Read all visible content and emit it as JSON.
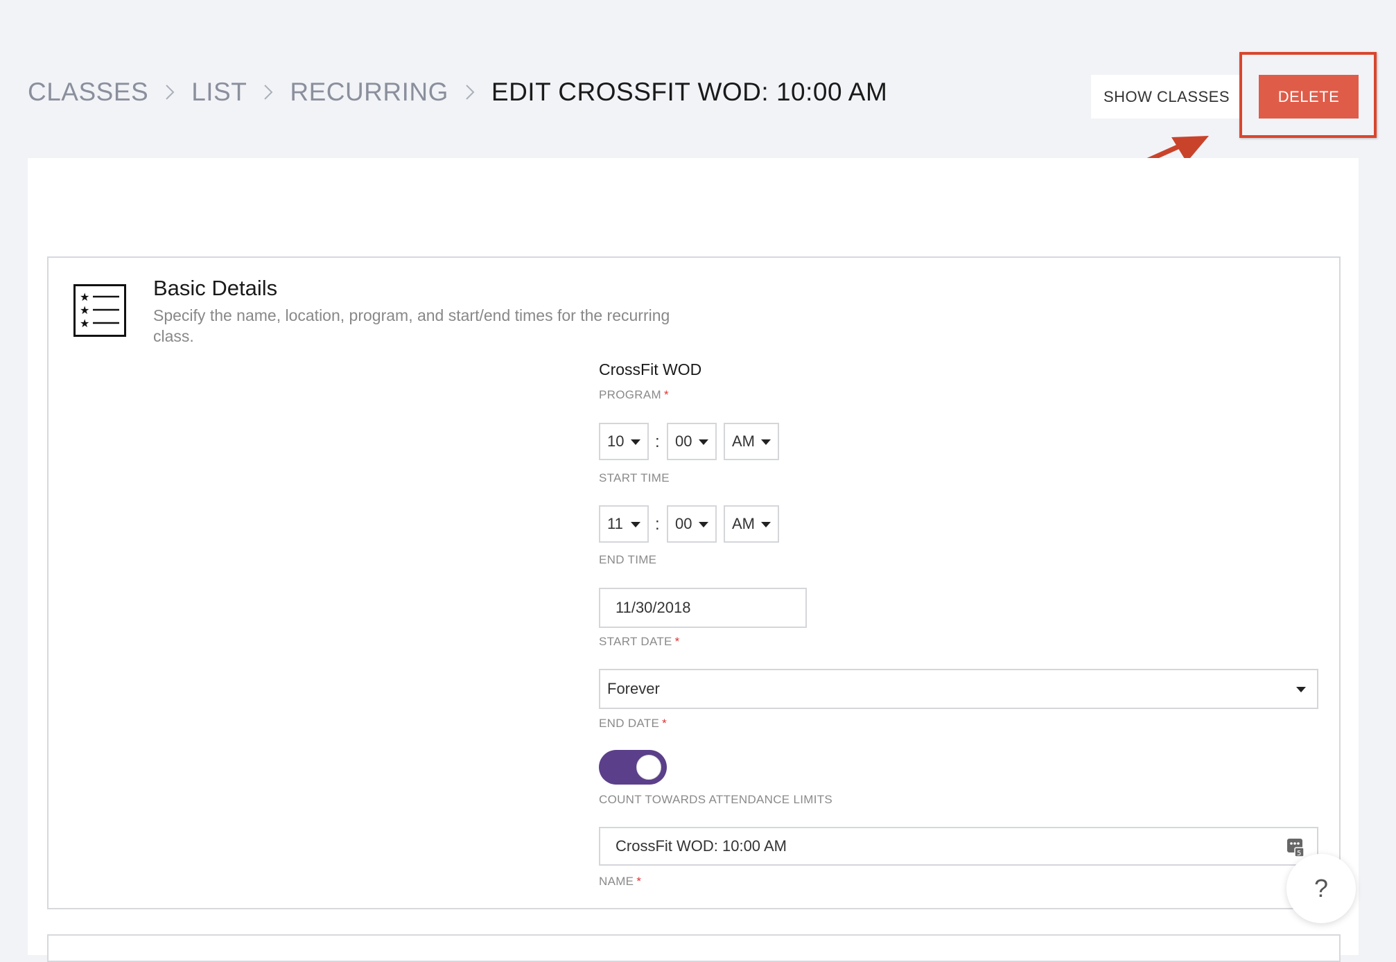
{
  "breadcrumb": {
    "items": [
      "CLASSES",
      "LIST",
      "RECURRING"
    ],
    "current": "EDIT CROSSFIT WOD: 10:00 AM"
  },
  "header": {
    "show_classes_label": "SHOW CLASSES",
    "delete_label": "DELETE"
  },
  "annotation": {
    "highlight_color": "#d9462c"
  },
  "section": {
    "title": "Basic Details",
    "description": "Specify the name, location, program, and start/end times for the recurring class."
  },
  "form": {
    "program": {
      "value": "CrossFit WOD",
      "label": "PROGRAM"
    },
    "start_time": {
      "hour": "10",
      "minute": "00",
      "ampm": "AM",
      "label": "START TIME",
      "separator": ":"
    },
    "end_time": {
      "hour": "11",
      "minute": "00",
      "ampm": "AM",
      "label": "END TIME",
      "separator": ":"
    },
    "start_date": {
      "value": "11/30/2018",
      "label": "START DATE"
    },
    "end_date": {
      "value": "Forever",
      "label": "END DATE"
    },
    "attendance_toggle": {
      "on": true,
      "label": "COUNT TOWARDS ATTENDANCE LIMITS"
    },
    "name": {
      "value": "CrossFit WOD: 10:00 AM",
      "label": "NAME"
    },
    "required_marker": "*"
  },
  "help": {
    "label": "?"
  },
  "colors": {
    "delete": "#df5c49",
    "toggle": "#5b3f8a",
    "background": "#f2f3f7"
  }
}
